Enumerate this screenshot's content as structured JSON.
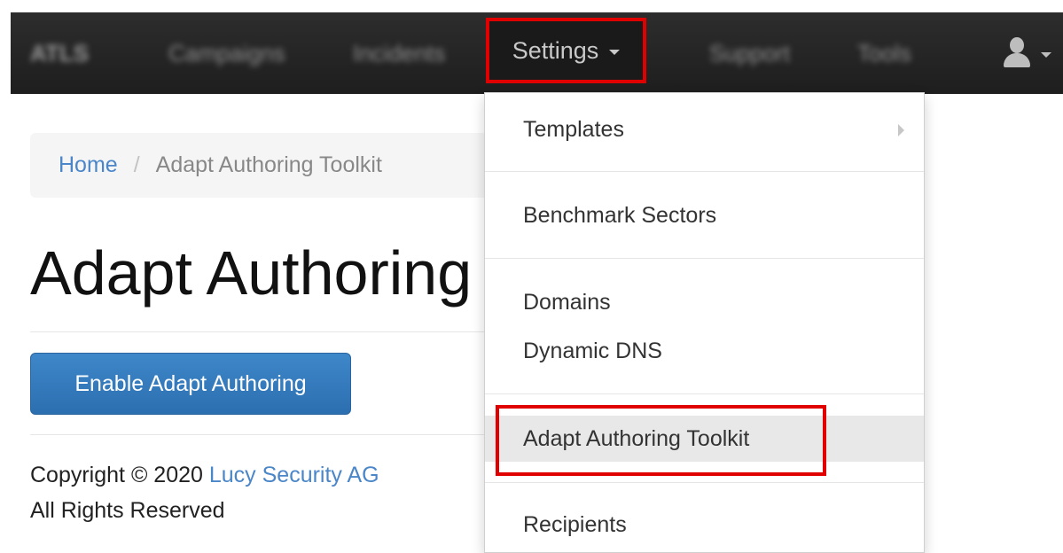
{
  "navbar": {
    "brand": "ATLS",
    "items": [
      "Campaigns",
      "Incidents",
      "Support",
      "Tools"
    ],
    "settings_label": "Settings",
    "user_icon": "user-icon"
  },
  "breadcrumb": {
    "home": "Home",
    "separator": "/",
    "current": "Adapt Authoring Toolkit"
  },
  "page": {
    "title": "Adapt Authoring",
    "enable_button": "Enable Adapt Authoring"
  },
  "footer": {
    "copyright_prefix": "Copyright © 2020",
    "company": "Lucy Security AG",
    "rights": "All Rights Reserved"
  },
  "dropdown": {
    "templates": "Templates",
    "benchmark_sectors": "Benchmark Sectors",
    "domains": "Domains",
    "dynamic_dns": "Dynamic DNS",
    "adapt_toolkit": "Adapt Authoring Toolkit",
    "recipients": "Recipients"
  },
  "colors": {
    "navbar": "#262626",
    "highlight": "#e00000",
    "link": "#4a86c8",
    "primary_button": "#337ab7"
  }
}
